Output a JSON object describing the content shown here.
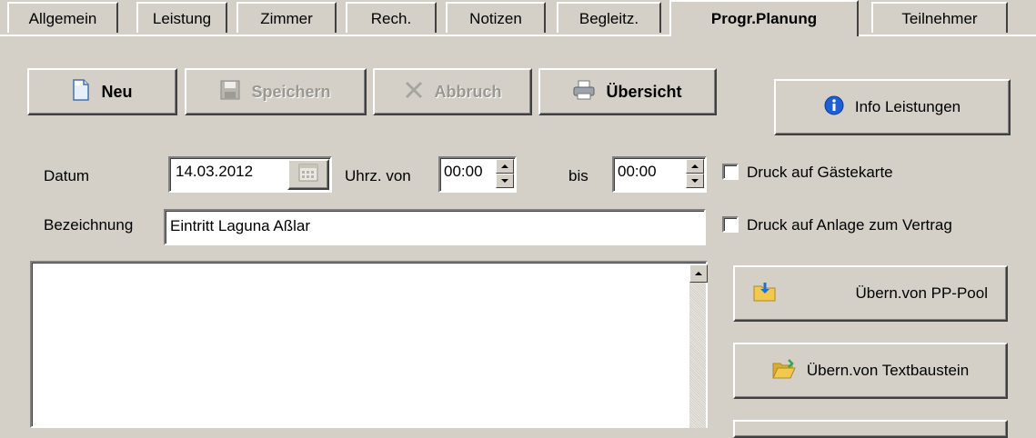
{
  "tabs": [
    {
      "label": "Allgemein"
    },
    {
      "label": "Leistung"
    },
    {
      "label": "Zimmer"
    },
    {
      "label": "Rech."
    },
    {
      "label": "Notizen"
    },
    {
      "label": "Begleitz."
    },
    {
      "label": "Progr.Planung",
      "active": true
    },
    {
      "label": "Teilnehmer"
    }
  ],
  "toolbar": {
    "new_label": "Neu",
    "save_label": "Speichern",
    "cancel_label": "Abbruch",
    "overview_label": "Übersicht",
    "info_label": "Info Leistungen"
  },
  "form": {
    "date_label": "Datum",
    "date_value": "14.03.2012",
    "time_from_label": "Uhrz. von",
    "time_from_value": "00:00",
    "time_to_label": "bis",
    "time_to_value": "00:00",
    "print_guest_card_label": "Druck auf Gästekarte",
    "print_guest_card_checked": false,
    "designation_label": "Bezeichnung",
    "designation_value": "Eintritt Laguna Aßlar",
    "print_contract_label": "Druck auf  Anlage zum Vertrag",
    "print_contract_checked": false,
    "notes_value": ""
  },
  "side_buttons": {
    "pp_pool_label": "Übern.von PP-Pool",
    "text_block_label": "Übern.von Textbaustein"
  },
  "icons": {
    "new": "document-icon",
    "save": "floppy-disk-icon",
    "cancel": "cross-icon",
    "overview": "printer-icon",
    "info": "info-icon",
    "pp_pool": "folder-download-icon",
    "text_block": "folder-open-icon",
    "calendar": "calendar-icon"
  },
  "colors": {
    "background": "#d4d0c8",
    "info_blue": "#1f5fd6",
    "folder_yellow": "#f2c94c"
  }
}
